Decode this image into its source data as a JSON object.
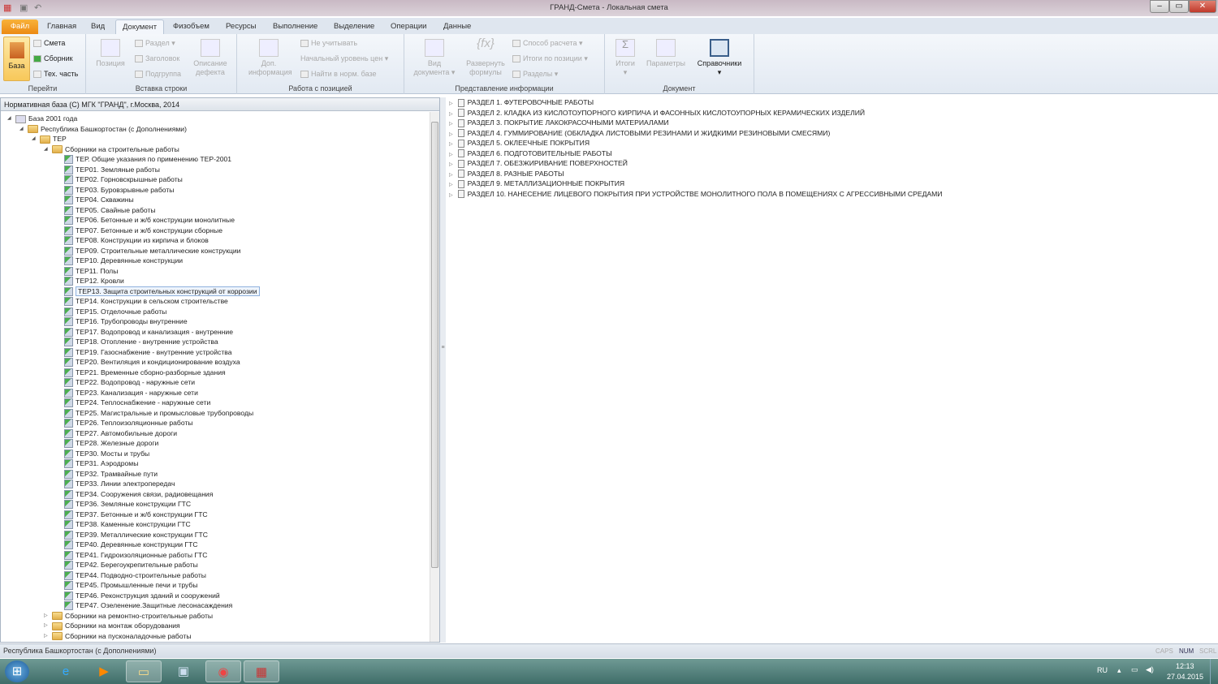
{
  "window": {
    "title": "ГРАНД-Смета - Локальная смета"
  },
  "tabs": [
    "Файл",
    "Главная",
    "Вид",
    "Документ",
    "Физобъем",
    "Ресурсы",
    "Выполнение",
    "Выделение",
    "Операции",
    "Данные"
  ],
  "ribbon": {
    "goto": {
      "label": "Перейти",
      "baza": "База",
      "smeta": "Смета",
      "sbornik": "Сборник",
      "tech": "Тех. часть"
    },
    "insert": {
      "label": "Вставка строки",
      "pozicia": "Позиция",
      "razdel": "Раздел",
      "zagolovok": "Заголовок",
      "podgruppa": "Подгруппа",
      "opisanie1": "Описание",
      "opisanie2": "дефекта"
    },
    "work": {
      "label": "Работа с позицией",
      "dop1": "Доп.",
      "dop2": "информация",
      "neuchit": "Не учитывать",
      "nach": "Начальный уровень цен",
      "najti": "Найти в норм. базе"
    },
    "view": {
      "label": "Представление информации",
      "vid1": "Вид",
      "vid2": "документа",
      "razv1": "Развернуть",
      "razv2": "формулы",
      "sposob": "Способ расчета",
      "itogi_poz": "Итоги по позиции",
      "razdely": "Разделы"
    },
    "doc": {
      "label": "Документ",
      "itogi": "Итоги",
      "params": "Параметры",
      "sprav": "Справочники"
    }
  },
  "left": {
    "header": "Нормативная база (С) МГК \"ГРАНД\", г.Москва, 2014",
    "tree": [
      {
        "level": 0,
        "type": "db",
        "exp": "open",
        "label": "База 2001 года"
      },
      {
        "level": 1,
        "type": "folder",
        "exp": "open",
        "label": "Республика Башкортостан (с Дополнениями)"
      },
      {
        "level": 2,
        "type": "folder",
        "exp": "open",
        "label": "ТЕР"
      },
      {
        "level": 3,
        "type": "folder",
        "exp": "open",
        "label": "Сборники на строительные работы"
      },
      {
        "level": 4,
        "type": "book",
        "label": "ТЕР. Общие указания по применению ТЕР-2001"
      },
      {
        "level": 4,
        "type": "book",
        "label": "ТЕР01. Земляные работы"
      },
      {
        "level": 4,
        "type": "book",
        "label": "ТЕР02. Горновскрышные работы"
      },
      {
        "level": 4,
        "type": "book",
        "label": "ТЕР03. Буровзрывные работы"
      },
      {
        "level": 4,
        "type": "book",
        "label": "ТЕР04. Скважины"
      },
      {
        "level": 4,
        "type": "book",
        "label": "ТЕР05. Свайные работы"
      },
      {
        "level": 4,
        "type": "book",
        "label": "ТЕР06. Бетонные и ж/б конструкции монолитные"
      },
      {
        "level": 4,
        "type": "book",
        "label": "ТЕР07. Бетонные и ж/б конструкции сборные"
      },
      {
        "level": 4,
        "type": "book",
        "label": "ТЕР08. Конструкции из кирпича и блоков"
      },
      {
        "level": 4,
        "type": "book",
        "label": "ТЕР09. Строительные металлические конструкции"
      },
      {
        "level": 4,
        "type": "book",
        "label": "ТЕР10. Деревянные конструкции"
      },
      {
        "level": 4,
        "type": "book",
        "label": "ТЕР11. Полы"
      },
      {
        "level": 4,
        "type": "book",
        "label": "ТЕР12. Кровли"
      },
      {
        "level": 4,
        "type": "book",
        "label": "ТЕР13. Защита строительных конструкций от коррозии",
        "selected": true
      },
      {
        "level": 4,
        "type": "book",
        "label": "ТЕР14. Конструкции в сельском строительстве"
      },
      {
        "level": 4,
        "type": "book",
        "label": "ТЕР15. Отделочные работы"
      },
      {
        "level": 4,
        "type": "book",
        "label": "ТЕР16. Трубопроводы внутренние"
      },
      {
        "level": 4,
        "type": "book",
        "label": "ТЕР17. Водопровод и канализация - внутренние"
      },
      {
        "level": 4,
        "type": "book",
        "label": "ТЕР18. Отопление - внутренние устройства"
      },
      {
        "level": 4,
        "type": "book",
        "label": "ТЕР19. Газоснабжение - внутренние устройства"
      },
      {
        "level": 4,
        "type": "book",
        "label": "ТЕР20. Вентиляция и кондиционирование воздуха"
      },
      {
        "level": 4,
        "type": "book",
        "label": "ТЕР21. Временные сборно-разборные здания"
      },
      {
        "level": 4,
        "type": "book",
        "label": "ТЕР22. Водопровод - наружные сети"
      },
      {
        "level": 4,
        "type": "book",
        "label": "ТЕР23. Канализация - наружные сети"
      },
      {
        "level": 4,
        "type": "book",
        "label": "ТЕР24. Теплоснабжение - наружные сети"
      },
      {
        "level": 4,
        "type": "book",
        "label": "ТЕР25. Магистральные и промысловые трубопроводы"
      },
      {
        "level": 4,
        "type": "book",
        "label": "ТЕР26. Теплоизоляционные работы"
      },
      {
        "level": 4,
        "type": "book",
        "label": "ТЕР27. Автомобильные дороги"
      },
      {
        "level": 4,
        "type": "book",
        "label": "ТЕР28. Железные дороги"
      },
      {
        "level": 4,
        "type": "book",
        "label": "ТЕР30. Мосты и трубы"
      },
      {
        "level": 4,
        "type": "book",
        "label": "ТЕР31. Аэродромы"
      },
      {
        "level": 4,
        "type": "book",
        "label": "ТЕР32. Трамвайные пути"
      },
      {
        "level": 4,
        "type": "book",
        "label": "ТЕР33. Линии электропередач"
      },
      {
        "level": 4,
        "type": "book",
        "label": "ТЕР34. Сооружения связи, радиовещания"
      },
      {
        "level": 4,
        "type": "book",
        "label": "ТЕР36. Земляные конструкции ГТС"
      },
      {
        "level": 4,
        "type": "book",
        "label": "ТЕР37. Бетонные и ж/б конструкции ГТС"
      },
      {
        "level": 4,
        "type": "book",
        "label": "ТЕР38. Каменные конструкции ГТС"
      },
      {
        "level": 4,
        "type": "book",
        "label": "ТЕР39. Металлические конструкции ГТС"
      },
      {
        "level": 4,
        "type": "book",
        "label": "ТЕР40. Деревянные конструкции ГТС"
      },
      {
        "level": 4,
        "type": "book",
        "label": "ТЕР41. Гидроизоляционные работы ГТС"
      },
      {
        "level": 4,
        "type": "book",
        "label": "ТЕР42. Берегоукрепительные работы"
      },
      {
        "level": 4,
        "type": "book",
        "label": "ТЕР44. Подводно-строительные работы"
      },
      {
        "level": 4,
        "type": "book",
        "label": "ТЕР45. Промышленные печи и трубы"
      },
      {
        "level": 4,
        "type": "book",
        "label": "ТЕР46. Реконструкция зданий и сооружений"
      },
      {
        "level": 4,
        "type": "book",
        "label": "ТЕР47. Озеленение.Защитные лесонасаждения"
      },
      {
        "level": 3,
        "type": "folder",
        "exp": "closed",
        "label": "Сборники на ремонтно-строительные работы"
      },
      {
        "level": 3,
        "type": "folder",
        "exp": "closed",
        "label": "Сборники на монтаж оборудования"
      },
      {
        "level": 3,
        "type": "folder",
        "exp": "closed",
        "label": "Сборники на пусконаладочные работы"
      }
    ]
  },
  "right": {
    "sections": [
      "РАЗДЕЛ 1. ФУТЕРОВОЧНЫЕ РАБОТЫ",
      "РАЗДЕЛ 2. КЛАДКА ИЗ КИСЛОТОУПОРНОГО КИРПИЧА И ФАСОННЫХ КИСЛОТОУПОРНЫХ КЕРАМИЧЕСКИХ ИЗДЕЛИЙ",
      "РАЗДЕЛ 3. ПОКРЫТИЕ ЛАКОКРАСОЧНЫМИ МАТЕРИАЛАМИ",
      "РАЗДЕЛ 4. ГУММИРОВАНИЕ (ОБКЛАДКА ЛИСТОВЫМИ РЕЗИНАМИ И ЖИДКИМИ РЕЗИНОВЫМИ СМЕСЯМИ)",
      "РАЗДЕЛ 5. ОКЛЕЕЧНЫЕ ПОКРЫТИЯ",
      "РАЗДЕЛ 6. ПОДГОТОВИТЕЛЬНЫЕ РАБОТЫ",
      "РАЗДЕЛ 7. ОБЕЗЖИРИВАНИЕ ПОВЕРХНОСТЕЙ",
      "РАЗДЕЛ 8. РАЗНЫЕ РАБОТЫ",
      "РАЗДЕЛ 9. МЕТАЛЛИЗАЦИОННЫЕ ПОКРЫТИЯ",
      "РАЗДЕЛ 10. НАНЕСЕНИЕ ЛИЦЕВОГО ПОКРЫТИЯ ПРИ УСТРОЙСТВЕ МОНОЛИТНОГО ПОЛА В ПОМЕЩЕНИЯХ С АГРЕССИВНЫМИ СРЕДАМИ"
    ]
  },
  "status": {
    "text": "Республика Башкортостан (с Дополнениями)",
    "caps": "CAPS",
    "num": "NUM",
    "scrl": "SCRL"
  },
  "taskbar": {
    "lang": "RU",
    "time": "12:13",
    "date": "27.04.2015"
  }
}
